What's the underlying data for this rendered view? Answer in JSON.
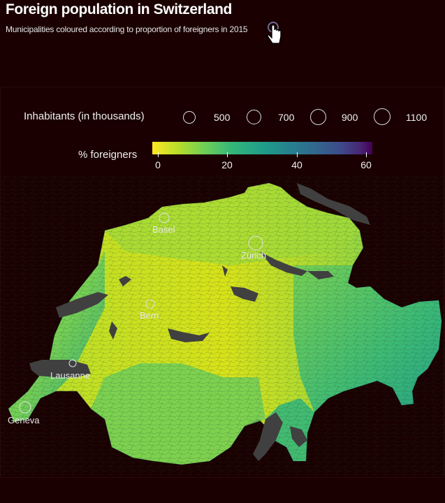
{
  "header": {
    "title": "Foreign population in Switzerland",
    "subtitle": "Municipalities coloured according to proportion of foreigners in 2015"
  },
  "size_legend": {
    "title": "Inhabitants (in thousands)",
    "items": [
      "500",
      "700",
      "900",
      "1100"
    ]
  },
  "color_legend": {
    "title": "% foreigners",
    "ticks": [
      "0",
      "20",
      "40",
      "60"
    ],
    "colors": [
      "#fde725",
      "#6ece58",
      "#1f9e89",
      "#31688e",
      "#440154"
    ]
  },
  "cities": [
    {
      "name": "Basel"
    },
    {
      "name": "Zürich"
    },
    {
      "name": "Bern"
    },
    {
      "name": "Lausanne"
    },
    {
      "name": "Geneva"
    }
  ],
  "theme": {
    "background": "#1a0000",
    "lakes": "#404040"
  },
  "icons": [
    "pointer-hand-icon"
  ]
}
